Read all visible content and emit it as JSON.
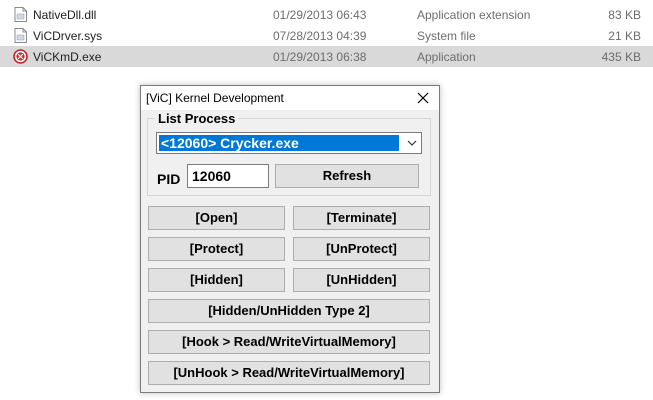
{
  "files": [
    {
      "name": "NativeDll.dll",
      "date": "01/29/2013 06:43",
      "type": "Application extension",
      "size": "83 KB",
      "selected": false,
      "icon": "document-icon"
    },
    {
      "name": "ViCDrver.sys",
      "date": "07/28/2013 04:39",
      "type": "System file",
      "size": "21 KB",
      "selected": false,
      "icon": "document-icon"
    },
    {
      "name": "ViCKmD.exe",
      "date": "01/29/2013 06:38",
      "type": "Application",
      "size": "435 KB",
      "selected": true,
      "icon": "app-icon"
    }
  ],
  "dialog": {
    "title": "[ViC] Kernel Development",
    "group_label": "List Process",
    "process_selected": "<12060> Crycker.exe",
    "pid_label": "PID",
    "pid_value": "12060",
    "refresh": "Refresh",
    "open": "[Open]",
    "terminate": "[Terminate]",
    "protect": "[Protect]",
    "unprotect": "[UnProtect]",
    "hidden": "[Hidden]",
    "unhidden": "[UnHidden]",
    "hidden_type2": "[Hidden/UnHidden Type 2]",
    "hook": "[Hook > Read/WriteVirtualMemory]",
    "unhook": "[UnHook > Read/WriteVirtualMemory]"
  },
  "colors": {
    "selection": "#0078d7",
    "row_selected": "#d9d9d9",
    "dialog_bg": "#f0f0f0"
  }
}
